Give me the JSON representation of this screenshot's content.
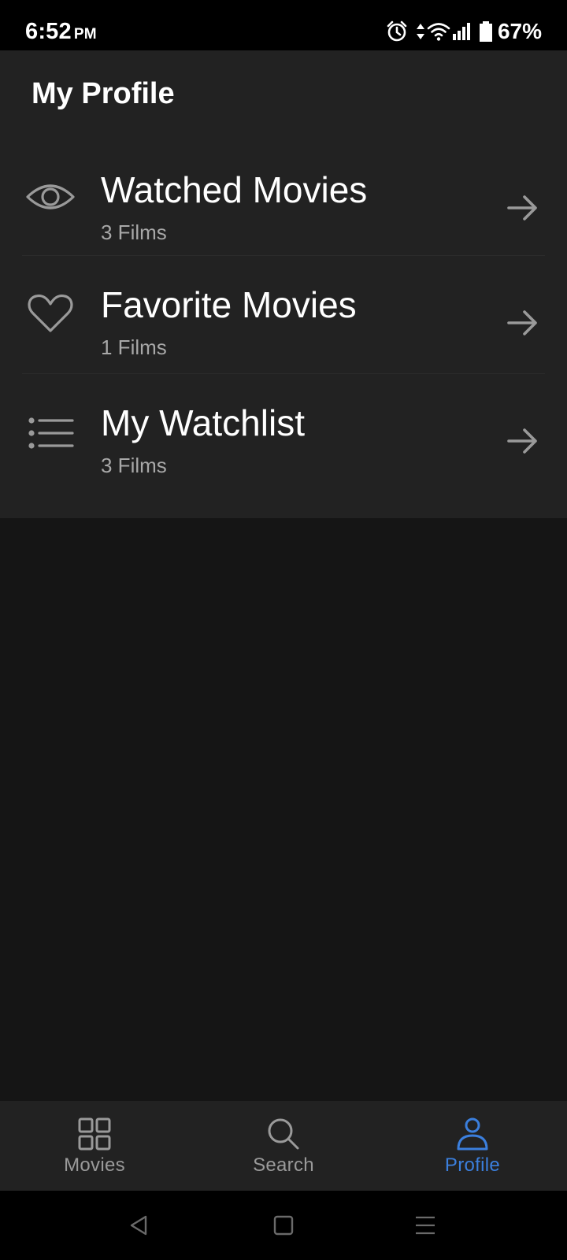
{
  "status_bar": {
    "time": "6:52",
    "ampm": "PM",
    "battery": "67%"
  },
  "header": {
    "title": "My Profile"
  },
  "menu": {
    "items": [
      {
        "title": "Watched Movies",
        "subtitle": "3 Films",
        "icon": "eye-icon"
      },
      {
        "title": "Favorite Movies",
        "subtitle": "1 Films",
        "icon": "heart-icon"
      },
      {
        "title": "My Watchlist",
        "subtitle": "3 Films",
        "icon": "list-icon"
      }
    ]
  },
  "bottom_nav": {
    "items": [
      {
        "label": "Movies",
        "icon": "grid-icon",
        "active": false
      },
      {
        "label": "Search",
        "icon": "search-icon",
        "active": false
      },
      {
        "label": "Profile",
        "icon": "user-icon",
        "active": true
      }
    ]
  },
  "colors": {
    "background": "#151515",
    "surface": "#222222",
    "accent": "#3b7fdd",
    "text_primary": "#ffffff",
    "text_secondary": "#a8a8a8",
    "icon_muted": "#9a9a9a"
  }
}
